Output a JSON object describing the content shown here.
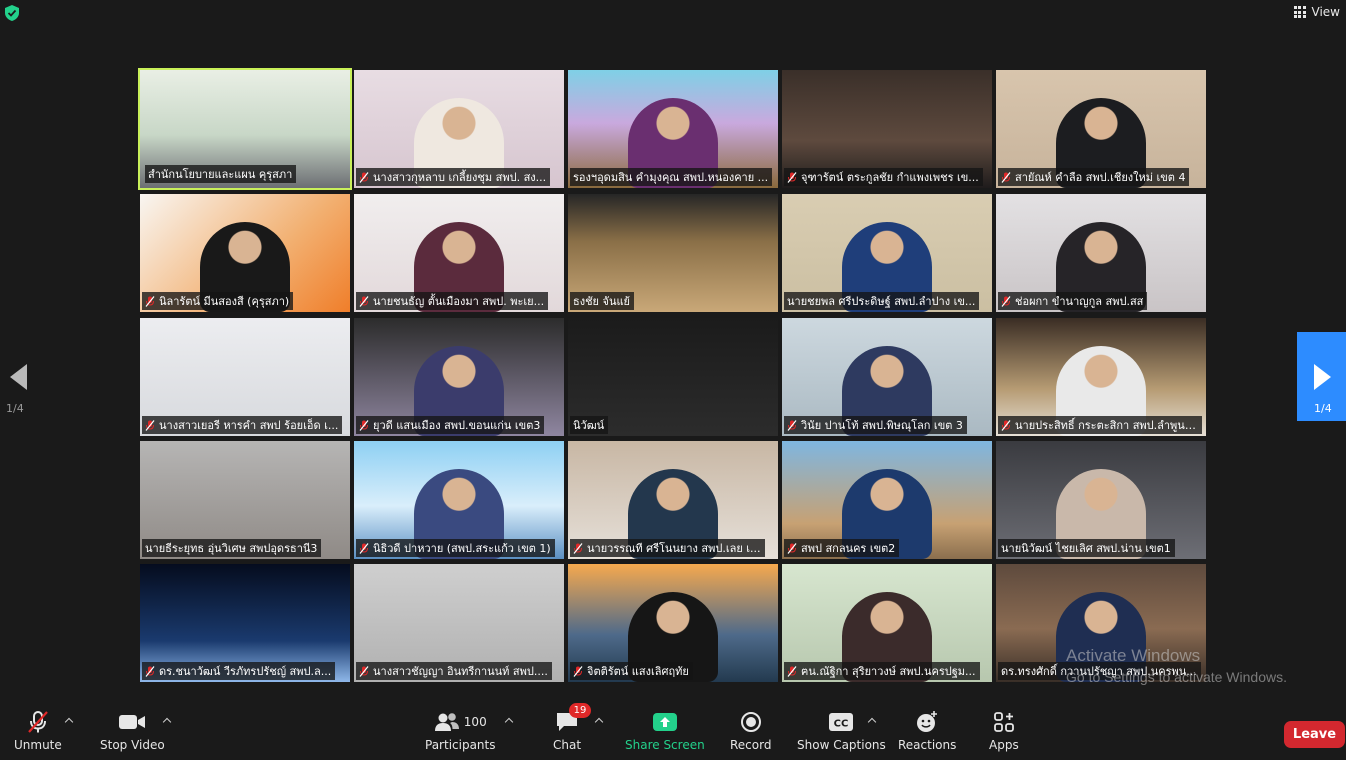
{
  "top": {
    "view_label": "View"
  },
  "nav": {
    "prev_page": "1/4",
    "next_page": "1/4"
  },
  "watermark": {
    "line1": "Activate Windows",
    "line2": "Go to Settings to activate Windows."
  },
  "tiles": [
    {
      "name": "สำนักนโยบายและแผน คุรุสภา",
      "muted": false
    },
    {
      "name": "นางสาวกุหลาบ เกลี้ยงชุม สพป. สง...",
      "muted": true
    },
    {
      "name": "รองฯอุดมสิน คำมุงคุณ สพป.หนองคาย ...",
      "muted": false
    },
    {
      "name": "จุฑารัตน์ ตระกูลชัย กำแพงเพชร เข...",
      "muted": true
    },
    {
      "name": "สายัณห์ คำลือ สพป.เชียงใหม่ เขต 4",
      "muted": true
    },
    {
      "name": "นิลารัตน์ มีนสองสี (คุรุสภา)",
      "muted": true
    },
    {
      "name": "นายชนธัญ ตั้นเมืองมา สพป. พะเย...",
      "muted": true
    },
    {
      "name": "ธงชัย จันแย้",
      "muted": false
    },
    {
      "name": "นายชยพล ศรีประดิษฐ์ สพป.ลำปาง เข...",
      "muted": false
    },
    {
      "name": "ช่อผกา ขำนาญกูล สพป.สส",
      "muted": true
    },
    {
      "name": "นางสาวเยอรี หารคำ สพป ร้อยเอ็ด เ...",
      "muted": true
    },
    {
      "name": "ยุวดี แสนเมือง สพป.ขอนแก่น เขต3",
      "muted": true
    },
    {
      "name": "นิวัฒน์",
      "muted": false
    },
    {
      "name": "วินัย ปานโท้ สพป.พิษณุโลก เขต 3",
      "muted": true
    },
    {
      "name": "นายประสิทธิ์ กระตะสิกา สพป.ลำพูน ...",
      "muted": true
    },
    {
      "name": "นายธีระยุทธ อุ่นวิเศษ สพปอุดรธานี3",
      "muted": false
    },
    {
      "name": "นิธิวดี ปาหวาย (สพป.สระแก้ว เขต 1)",
      "muted": true
    },
    {
      "name": "นายวรรณที ศรีโนนยาง สพป.เลย เ...",
      "muted": true
    },
    {
      "name": "สพป สกลนคร เขต2",
      "muted": true
    },
    {
      "name": "นายนิวัฒน์ ไชยเลิศ สพป.น่าน เขต1",
      "muted": false
    },
    {
      "name": "ดร.ชนาวัฒน์ วีรภัทรปรัชญ์ สพป.ล...",
      "muted": true
    },
    {
      "name": "นางสาวชัญญา อินทรีกานนท์ สพป....",
      "muted": true
    },
    {
      "name": "จิตติรัตน์ แสงเลิศฤทัย",
      "muted": true
    },
    {
      "name": "ฅน.ณัฐิกา สุริยาวงษ์ สพป.นครปฐม...",
      "muted": true
    },
    {
      "name": "ดร.ทรงศักดิ์ กวานปรัชญา สพป.นครพน...",
      "muted": false
    }
  ],
  "toolbar": {
    "unmute": "Unmute",
    "stop_video": "Stop Video",
    "participants": "Participants",
    "participants_count": "100",
    "chat": "Chat",
    "chat_badge": "19",
    "share_screen": "Share Screen",
    "record": "Record",
    "show_captions": "Show Captions",
    "reactions": "Reactions",
    "apps": "Apps",
    "leave": "Leave"
  },
  "colors": {
    "accent": "#2d8cff",
    "leave": "#d3282f",
    "share": "#23d18b",
    "active_speaker": "#c9f05a",
    "badge": "#e02828"
  }
}
